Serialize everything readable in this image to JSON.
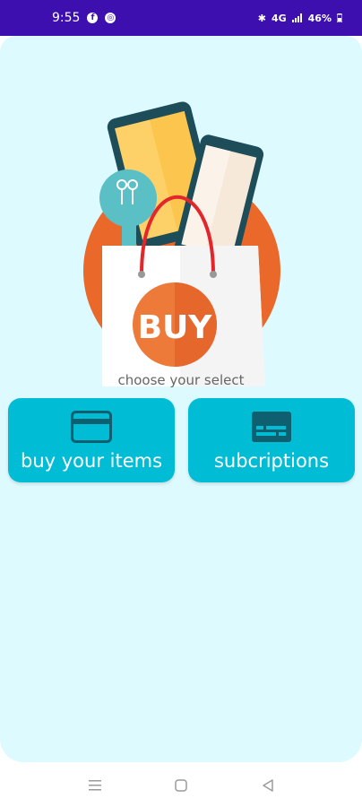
{
  "status_bar": {
    "time": "9:55",
    "icons_left": [
      "facebook-icon",
      "chrome-icon"
    ],
    "bluetooth": "✱",
    "network_type": "4G",
    "battery_percent": "46%",
    "background_color": "#3d0fae"
  },
  "hero": {
    "bag_text": "BUY",
    "colors": {
      "circle": "#e9682a",
      "bag": "#ffffff",
      "bulb": "#5bbfc6",
      "phone_dark": "#1e4d5a",
      "phone_screen": "#fcc64e",
      "handle": "#e3262b"
    }
  },
  "prompt": {
    "text": "choose your select"
  },
  "options": [
    {
      "label": "buy your items",
      "icon": "credit-card-icon"
    },
    {
      "label": "subcriptions",
      "icon": "subtitles-icon"
    }
  ],
  "theme": {
    "card_background": "#dcfaff",
    "button_color": "#00bcd4",
    "button_icon_color": "#0e5f70"
  },
  "navigation": {
    "items": [
      "menu-icon",
      "home-icon",
      "back-icon"
    ]
  }
}
